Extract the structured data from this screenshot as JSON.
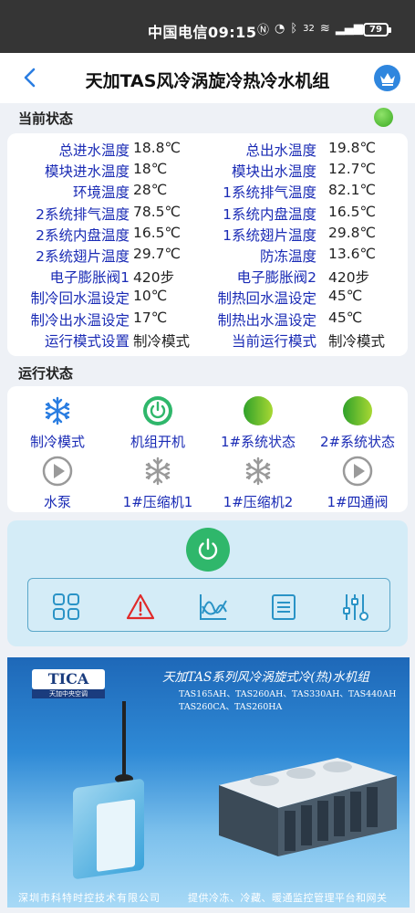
{
  "status_bar": {
    "carrier": "中国电信",
    "time": "09:15",
    "net_speed": "32",
    "battery": "79"
  },
  "header": {
    "title": "天加TAS风冷涡旋冷热冷水机组"
  },
  "current_status": {
    "section_title": "当前状态",
    "led_color": "#3aa922",
    "rows": [
      {
        "label1": "总进水温度",
        "value1": "18.8℃",
        "label2": "总出水温度",
        "value2": "19.8℃"
      },
      {
        "label1": "模块进水温度",
        "value1": "18℃",
        "label2": "模块出水温度",
        "value2": "12.7℃"
      },
      {
        "label1": "环境温度",
        "value1": "28℃",
        "label2": "1系统排气温度",
        "value2": "82.1℃"
      },
      {
        "label1": "2系统排气温度",
        "value1": "78.5℃",
        "label2": "1系统内盘温度",
        "value2": "16.5℃"
      },
      {
        "label1": "2系统内盘温度",
        "value1": "16.5℃",
        "label2": "1系统翅片温度",
        "value2": "29.8℃"
      },
      {
        "label1": "2系统翅片温度",
        "value1": "29.7℃",
        "label2": "防冻温度",
        "value2": "13.6℃"
      },
      {
        "label1": "电子膨胀阀1",
        "value1": "420步",
        "label2": "电子膨胀阀2",
        "value2": "420步"
      },
      {
        "label1": "制冷回水温设定",
        "value1": "10℃",
        "label2": "制热回水温设定",
        "value2": "45℃"
      },
      {
        "label1": "制冷出水温设定",
        "value1": "17℃",
        "label2": "制热出水温设定",
        "value2": "45℃"
      },
      {
        "label1": "运行模式设置",
        "value1": "制冷模式",
        "label2": "当前运行模式",
        "value2": "制冷模式"
      }
    ]
  },
  "run_status": {
    "section_title": "运行状态",
    "items": [
      {
        "label": "制冷模式",
        "icon": "snowflake-icon",
        "state": "active-blue"
      },
      {
        "label": "机组开机",
        "icon": "power-icon",
        "state": "active-green"
      },
      {
        "label": "1#系统状态",
        "icon": "status-dot-icon",
        "state": "active-green"
      },
      {
        "label": "2#系统状态",
        "icon": "status-dot-icon",
        "state": "active-green"
      },
      {
        "label": "水泵",
        "icon": "play-icon",
        "state": "inactive"
      },
      {
        "label": "1#压缩机1",
        "icon": "snowflake-icon",
        "state": "inactive"
      },
      {
        "label": "1#压缩机2",
        "icon": "snowflake-icon",
        "state": "inactive"
      },
      {
        "label": "1#四通阀",
        "icon": "play-icon",
        "state": "inactive"
      }
    ]
  },
  "controls": {
    "power_icon": "power-icon",
    "tools": [
      "grid-icon",
      "alarm-icon",
      "chart-icon",
      "list-icon",
      "settings-sliders-icon"
    ]
  },
  "banner": {
    "logo": "TICA",
    "logo_sub": "天加中央空调",
    "title": "天加TAS系列风冷涡旋式冷(热)水机组",
    "models": "TAS165AH、TAS260AH、TAS330AH、TAS440AH TAS260CA、TAS260HA",
    "footer_left": "深圳市科特时控技术有限公司",
    "footer_right": "提供冷冻、冷藏、暖通监控管理平台和网关"
  }
}
